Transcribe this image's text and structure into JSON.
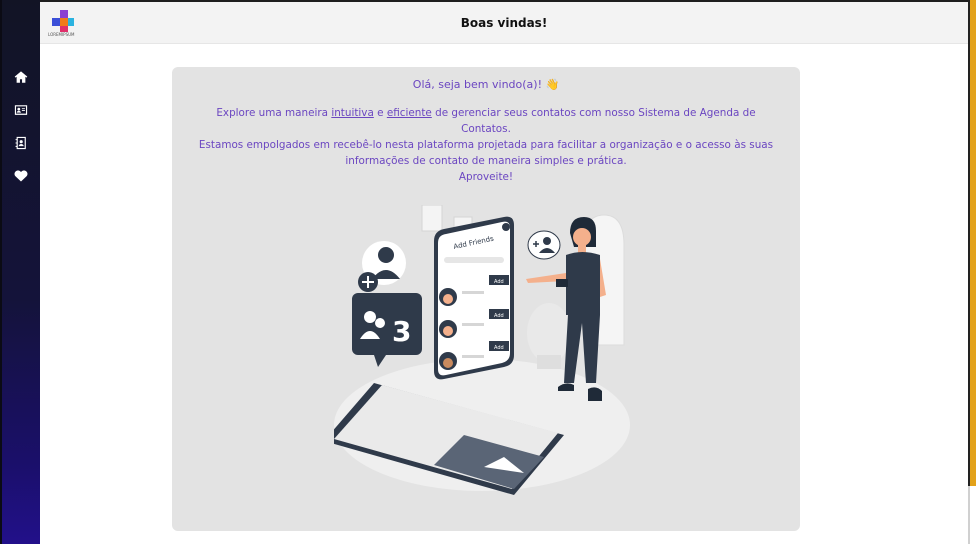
{
  "header": {
    "title": "Boas vindas!",
    "logo_text": "LOREMIPSUM"
  },
  "sidebar": {
    "items": [
      {
        "name": "home",
        "icon": "home-icon"
      },
      {
        "name": "contacts-card",
        "icon": "contact-card-icon"
      },
      {
        "name": "address-book",
        "icon": "address-book-icon"
      },
      {
        "name": "favorites",
        "icon": "heart-icon"
      }
    ]
  },
  "welcome": {
    "greeting": "Olá, seja bem vindo(a)! 👋",
    "line1_before": "Explore uma maneira ",
    "line1_link1": "intuitiva",
    "line1_mid": " e ",
    "line1_link2": "eficiente",
    "line1_after": " de gerenciar seus contatos com nosso Sistema de Agenda de",
    "line2": "Contatos.",
    "line3": "Estamos empolgados em recebê-lo nesta plataforma projetada para facilitar a organização e o acesso às suas",
    "line4": "informações de contato de maneira simples e prática.",
    "line5": "Aproveite!"
  },
  "illustration": {
    "phone_title": "Add Friends",
    "add_label": "Add",
    "badge_count": "3"
  },
  "colors": {
    "accent": "#6b46c1",
    "sidebar_dark": "#121425",
    "sidebar_blue": "#22108a",
    "orange_edge": "#e3a21a",
    "card_bg": "#e3e3e3",
    "illustration_dark": "#2f3a4a",
    "skin": "#f4b08c"
  }
}
